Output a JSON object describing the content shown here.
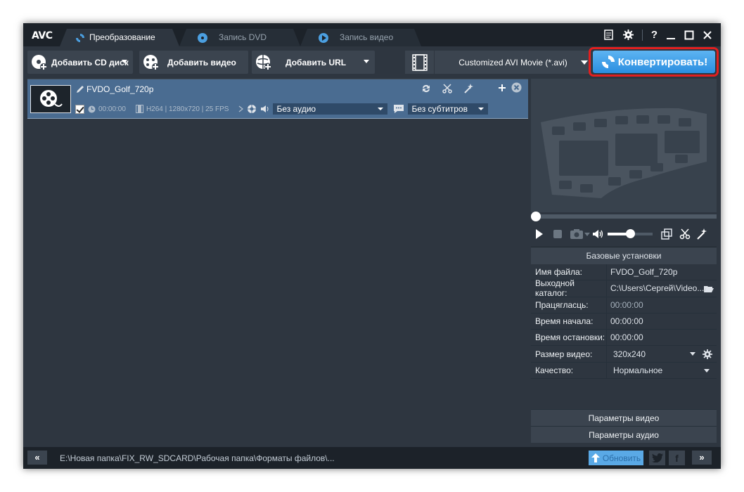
{
  "app": {
    "logo": "AVC"
  },
  "tabs": [
    {
      "label": "Преобразование",
      "active": true,
      "icon": "convert-icon"
    },
    {
      "label": "Запись DVD",
      "active": false,
      "icon": "disc-icon"
    },
    {
      "label": "Запись видео",
      "active": false,
      "icon": "play-icon"
    }
  ],
  "window_controls": {
    "help": "?"
  },
  "toolbar": {
    "add_cd": "Добавить CD диск",
    "add_video": "Добавить видео",
    "add_url": "Добавить URL",
    "format": "Customized AVI Movie (*.avi)",
    "convert": "Конвертировать!"
  },
  "file": {
    "name": "FVDO_Golf_720p",
    "duration": "00:00:00",
    "codec_info": "H264 | 1280x720 | 25 FPS",
    "audio": "Без аудио",
    "subtitles": "Без субтитров",
    "checked": true
  },
  "settings": {
    "title": "Базовые установки",
    "rows": [
      {
        "label": "Имя файла:",
        "value": "FVDO_Golf_720p",
        "dim": false
      },
      {
        "label": "Выходной каталог:",
        "value": "C:\\Users\\Сергей\\Video...",
        "dim": false
      },
      {
        "label": "Працягласць:",
        "value": "00:00:00",
        "dim": true
      },
      {
        "label": "Время начала:",
        "value": "00:00:00",
        "dim": false
      },
      {
        "label": "Время остановки:",
        "value": "00:00:00",
        "dim": false
      },
      {
        "label": "Размер видео:",
        "value": "320x240",
        "dim": false
      },
      {
        "label": "Качество:",
        "value": "Нормальное",
        "dim": false
      }
    ],
    "video_params": "Параметры видео",
    "audio_params": "Параметры аудио"
  },
  "player": {
    "volume": 0.5,
    "position": 0.0
  },
  "status": {
    "path": "E:\\Новая папка\\FIX_RW_SDCARD\\Рабочая папка\\Форматы файлов\\...",
    "update": "Обновить",
    "facebook": "f"
  },
  "colors": {
    "accent": "#2b8ee0",
    "highlight_outline": "#e21f1f",
    "selected_row": "#4a6c91"
  }
}
